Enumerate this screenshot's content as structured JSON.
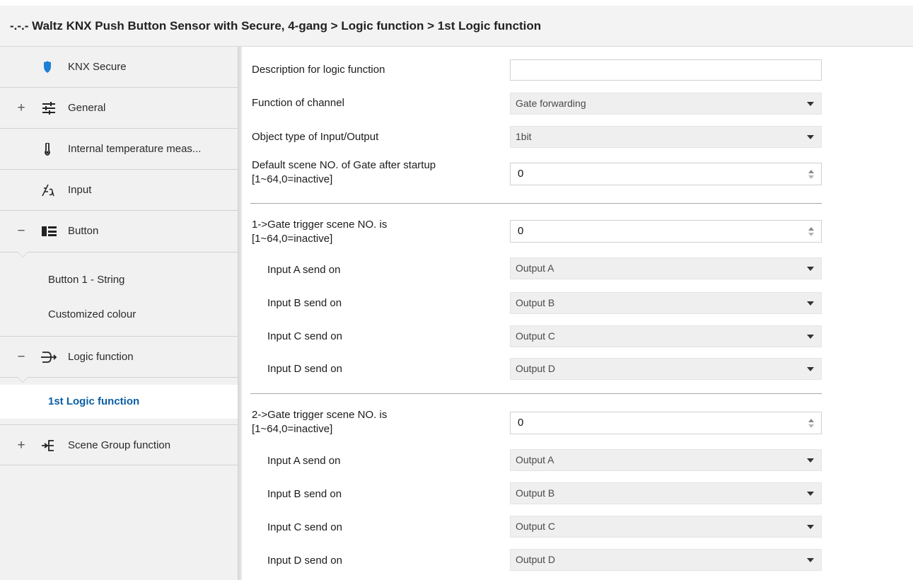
{
  "title": "-.-.- Waltz KNX Push Button Sensor with Secure, 4-gang > Logic function > 1st Logic function",
  "sidebar": {
    "items": [
      {
        "label": "KNX Secure",
        "icon": "shield-icon",
        "expander": ""
      },
      {
        "label": "General",
        "icon": "sliders-icon",
        "expander": "+"
      },
      {
        "label": "Internal temperature meas...",
        "icon": "thermometer-icon",
        "expander": ""
      },
      {
        "label": "Input",
        "icon": "input-icon",
        "expander": ""
      },
      {
        "label": "Button",
        "icon": "button-icon",
        "expander": "−"
      },
      {
        "label": "Logic function",
        "icon": "logic-icon",
        "expander": "−"
      },
      {
        "label": "Scene Group function",
        "icon": "scene-group-icon",
        "expander": "+"
      }
    ],
    "button_children": [
      "Button 1 - String",
      "Customized colour"
    ],
    "logic_children": [
      "1st Logic function"
    ]
  },
  "params": {
    "description_label": "Description for logic function",
    "description_value": "",
    "function_label": "Function of channel",
    "function_value": "Gate forwarding",
    "object_type_label": "Object type of Input/Output",
    "object_type_value": "1bit",
    "default_scene_label_1": "Default scene NO. of Gate after startup",
    "default_scene_label_2": "[1~64,0=inactive]",
    "default_scene_value": "0"
  },
  "gates": [
    {
      "label_1": "1->Gate trigger scene NO. is",
      "label_2": "[1~64,0=inactive]",
      "value": "0",
      "inputs": [
        {
          "label": "Input A send on",
          "value": "Output A"
        },
        {
          "label": "Input B send on",
          "value": "Output B"
        },
        {
          "label": "Input C send on",
          "value": "Output C"
        },
        {
          "label": "Input D send on",
          "value": "Output D"
        }
      ]
    },
    {
      "label_1": "2->Gate trigger scene NO. is",
      "label_2": "[1~64,0=inactive]",
      "value": "0",
      "inputs": [
        {
          "label": "Input A send on",
          "value": "Output A"
        },
        {
          "label": "Input B send on",
          "value": "Output B"
        },
        {
          "label": "Input C send on",
          "value": "Output C"
        },
        {
          "label": "Input D send on",
          "value": "Output D"
        }
      ]
    }
  ],
  "colors": {
    "accent": "#0b5fa5",
    "shield": "#1e7fd6",
    "sidebar_bg": "#f1f1f1",
    "dropdown_bg": "#efefef"
  }
}
